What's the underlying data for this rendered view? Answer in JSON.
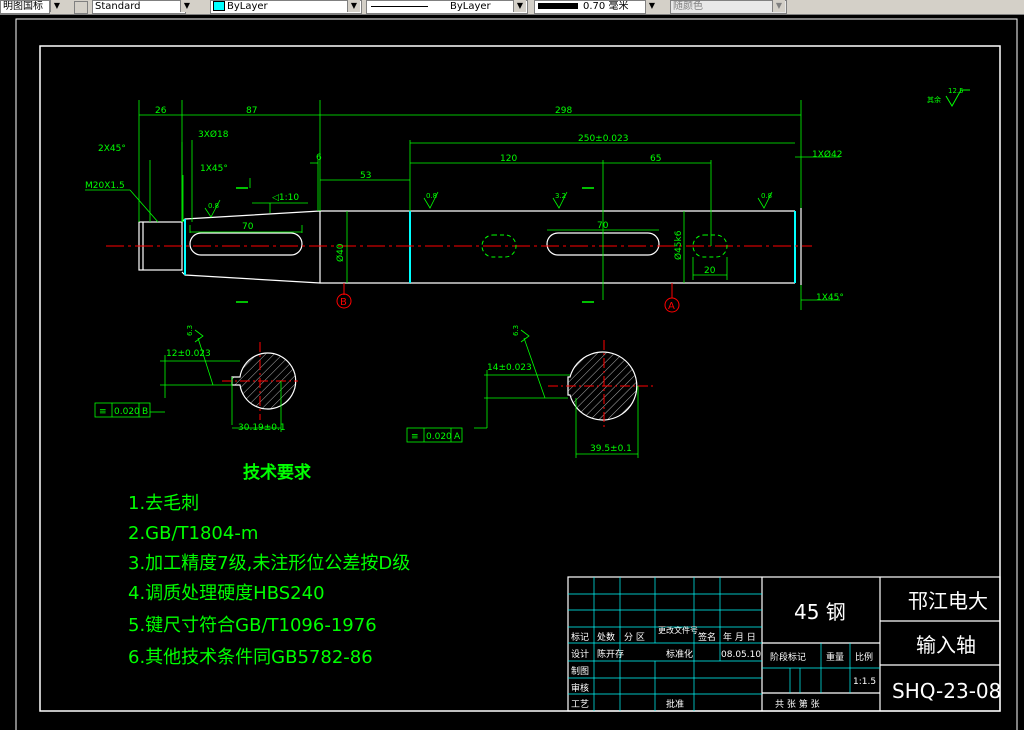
{
  "toolbar": {
    "dimstyle": "明图国标",
    "textstyle": "Standard",
    "layer_color": "ByLayer",
    "linetype": "ByLayer",
    "lineweight": "0.70 毫米",
    "plotstyle": "随颜色"
  },
  "drawing": {
    "roughness_global": "12.5",
    "roughness_global_prefix": "其余",
    "dims": {
      "d26": "26",
      "d87": "87",
      "d298": "298",
      "d250": "250±0.023",
      "d120": "120",
      "d65": "65",
      "d53": "53",
      "d6": "6",
      "chamfer_left": "2X45°",
      "thread": "M20X1.5",
      "groove": "3XØ18",
      "chamfer_1x45_left": "1X45°",
      "taper": "◁1:10",
      "d70_left": "70",
      "d70_right": "70",
      "dia40": "Ø40",
      "dia45": "Ø45k6",
      "d20": "20",
      "dia42": "1XØ42",
      "chamfer_1x45_right": "1X45°",
      "ra_08a": "0.8",
      "ra_32": "3.2",
      "ra_08b": "0.8",
      "ra_08c": "0.8",
      "ra_63a": "6.3",
      "ra_63b": "6.3",
      "key_left_w": "12±0.023",
      "key_left_depth": "30.19±0.1",
      "key_right_w": "14±0.023",
      "key_right_depth": "39.5±0.1",
      "tol_left_val": "0.020",
      "tol_left_ref": "B",
      "tol_right_val": "0.020",
      "tol_right_ref": "A",
      "section_b": "B",
      "section_a": "A"
    },
    "tech": {
      "title": "技术要求",
      "items": [
        "1.去毛刺",
        "2.GB/T1804-m",
        "3.加工精度7级,未注形位公差按D级",
        "4.调质处理硬度HBS240",
        "5.键尺寸符合GB/T1096-1976",
        "6.其他技术条件同GB5782-86"
      ]
    },
    "titleblock": {
      "material": "45 钢",
      "school": "邗江电大",
      "part_name": "输入轴",
      "drawing_no": "SHQ-23-08",
      "headers": [
        "标记",
        "处数",
        "分 区",
        "更改文件号",
        "签名",
        "年 月 日"
      ],
      "design": "设计",
      "designer": "陈开存",
      "standardize": "标准化",
      "date": "08.05.10",
      "stage_mark": "阶段标记",
      "weight": "重量",
      "scale": "比例",
      "scale_val": "1:1.5",
      "drawn": "制图",
      "review": "审核",
      "process": "工艺",
      "approve": "批准",
      "sheets": "共    张  第    张"
    }
  }
}
